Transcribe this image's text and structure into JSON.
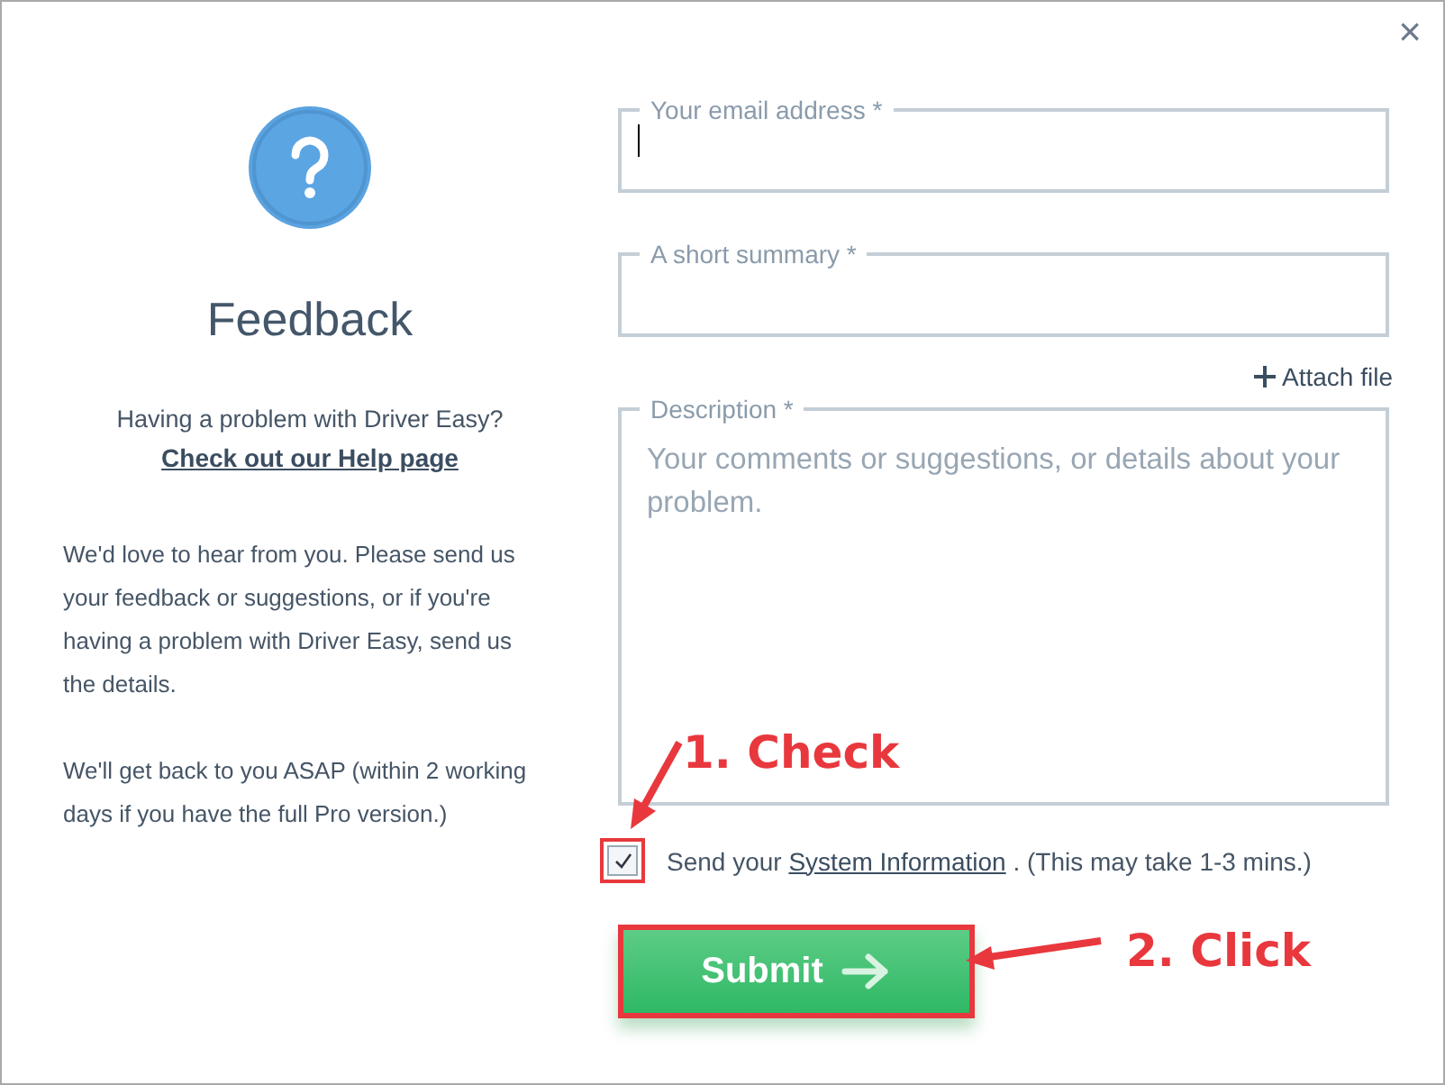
{
  "window": {
    "close": "×"
  },
  "intro": {
    "title": "Feedback",
    "question": "Having a problem with Driver Easy?",
    "help_link": "Check out our Help page",
    "paragraphs": [
      "We'd love to hear from you. Please send us your feedback or suggestions, or if you're having a problem with Driver Easy, send us the details.",
      "We'll get back to you ASAP (within 2 working days if you have the full Pro version.)"
    ]
  },
  "fields": [
    {
      "kind": "input",
      "label": "Your email address *",
      "focused": true
    },
    {
      "kind": "input",
      "label": "A short summary *",
      "focused": false
    },
    {
      "kind": "attach",
      "label": "Attach file"
    },
    {
      "kind": "textarea",
      "label": "Description *",
      "placeholder": "Your comments or suggestions, or details about your problem.",
      "focused": false
    }
  ],
  "system_info": {
    "checked": true,
    "before": "Send your",
    "link": "System Information",
    "after": ". (This may take 1-3 mins.)"
  },
  "submit": {
    "label": "Submit"
  },
  "annotations": [
    {
      "text": "1. Check"
    },
    {
      "text": "2. Click"
    }
  ]
}
